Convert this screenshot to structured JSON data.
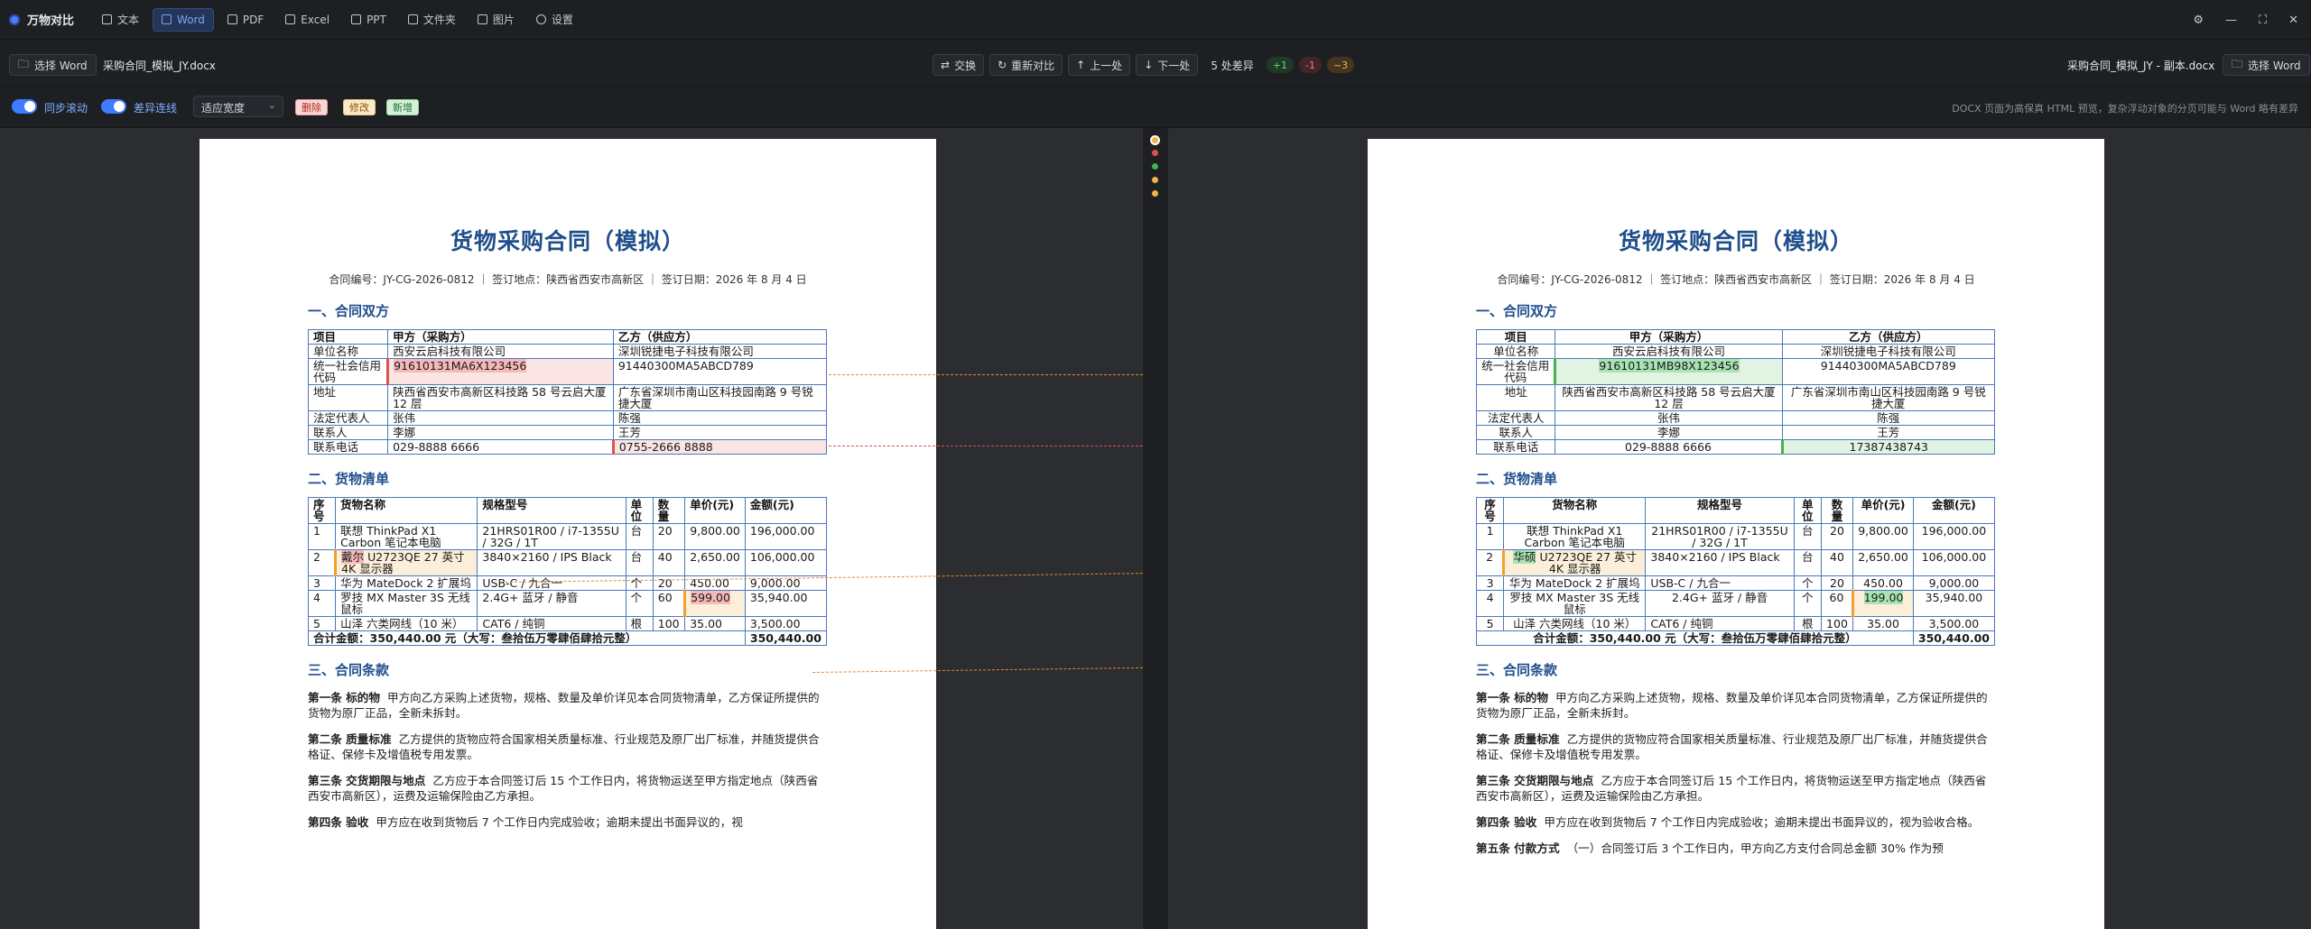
{
  "app": {
    "title": "万物对比"
  },
  "nav": [
    {
      "label": "文本",
      "icon": "document-text-icon"
    },
    {
      "label": "Word",
      "icon": "word-icon",
      "active": true
    },
    {
      "label": "PDF",
      "icon": "pdf-icon"
    },
    {
      "label": "Excel",
      "icon": "excel-icon"
    },
    {
      "label": "PPT",
      "icon": "ppt-icon"
    },
    {
      "label": "文件夹",
      "icon": "folder-icon"
    },
    {
      "label": "图片",
      "icon": "image-icon"
    },
    {
      "label": "设置",
      "icon": "gear-icon"
    }
  ],
  "window": {
    "settings": "⚙",
    "minimize": "—",
    "maximize": "⛶",
    "close": "✕"
  },
  "toolbar": {
    "select_left": "选择 Word",
    "left_file": "采购合同_模拟_JY.docx",
    "swap": "交换",
    "recompare": "重新对比",
    "prev": "上一处",
    "next": "下一处",
    "diff_count": "5 处差异",
    "added": "+1",
    "removed": "-1",
    "modified": "~3",
    "right_file": "采购合同_模拟_JY - 副本.docx",
    "select_right": "选择 Word"
  },
  "options": {
    "sync_scroll": "同步滚动",
    "diff_lines": "差异连线",
    "fit": "适应宽度",
    "legend_del": "删除",
    "legend_mod": "修改",
    "legend_add": "新增",
    "notice": "DOCX 页面为高保真 HTML 预览，复杂浮动对象的分页可能与 Word 略有差异"
  },
  "doc": {
    "title": "货物采购合同（模拟）",
    "meta": "合同编号：JY-CG-2026-0812 ｜ 签订地点：陕西省西安市高新区 ｜ 签订日期：2026 年 8 月 4 日",
    "s1": "一、合同双方",
    "parties_head": [
      "项目",
      "甲方（采购方）",
      "乙方（供应方）"
    ],
    "unit_name": [
      "单位名称",
      "西安云启科技有限公司",
      "深圳锐捷电子科技有限公司"
    ],
    "credit_label": "统一社会信用代码",
    "credit_a_left": "91610131MA6X123456",
    "credit_a_right": "91610131MB98X123456",
    "credit_b": "91440300MA5ABCD789",
    "addr": [
      "地址",
      "陕西省西安市高新区科技路 58 号云启大厦 12 层",
      "广东省深圳市南山区科技园南路 9 号锐捷大厦"
    ],
    "rep": [
      "法定代表人",
      "张伟",
      "陈强"
    ],
    "contact": [
      "联系人",
      "李娜",
      "王芳"
    ],
    "phone_label": "联系电话",
    "phone_a": "029-8888 6666",
    "phone_b_left": "0755-2666 8888",
    "phone_b_right": "17387438743",
    "s2": "二、货物清单",
    "goods_head": [
      "序号",
      "货物名称",
      "规格型号",
      "单位",
      "数量",
      "单价(元)",
      "金额(元)"
    ],
    "goods": [
      [
        "1",
        "联想 ThinkPad X1 Carbon 笔记本电脑",
        "21HRS01R00 / i7-1355U / 32G / 1T",
        "台",
        "20",
        "9,800.00",
        "196,000.00"
      ],
      [
        "2",
        "U2723QE 27 英寸 4K 显示器",
        "3840×2160 / IPS Black",
        "台",
        "40",
        "2,650.00",
        "106,000.00"
      ],
      [
        "3",
        "华为 MateDock 2 扩展坞",
        "USB-C / 九合一",
        "个",
        "20",
        "450.00",
        "9,000.00"
      ],
      [
        "4",
        "罗技 MX Master 3S 无线鼠标",
        "2.4G+ 蓝牙 / 静音",
        "个",
        "60",
        "",
        "35,940.00"
      ],
      [
        "5",
        "山泽 六类网线（10 米）",
        "CAT6 / 纯铜",
        "根",
        "100",
        "35.00",
        "3,500.00"
      ]
    ],
    "brand_left": "戴尔",
    "brand_right": "华硕",
    "price_left": "599.00",
    "price_right": "199.00",
    "total_label": "合计金额：350,440.00 元（大写：叁拾伍万零肆佰肆拾元整）",
    "total_value": "350,440.00",
    "s3": "三、合同条款",
    "c1_t": "第一条 标的物",
    "c1": "甲方向乙方采购上述货物，规格、数量及单价详见本合同货物清单，乙方保证所提供的货物为原厂正品，全新未拆封。",
    "c2_t": "第二条 质量标准",
    "c2": "乙方提供的货物应符合国家相关质量标准、行业规范及原厂出厂标准，并随货提供合格证、保修卡及增值税专用发票。",
    "c3_t": "第三条 交货期限与地点",
    "c3": "乙方应于本合同签订后 15 个工作日内，将货物运送至甲方指定地点（陕西省西安市高新区），运费及运输保险由乙方承担。",
    "c4_t": "第四条 验收",
    "c4_left": "甲方应在收到货物后 7 个工作日内完成验收；逾期未提出书面异议的，视",
    "c4_right": "甲方应在收到货物后 7 个工作日内完成验收；逾期未提出书面异议的，视为验收合格。",
    "c5_t": "第五条 付款方式",
    "c5": "（一）合同签订后 3 个工作日内，甲方向乙方支付合同总金额 30% 作为预"
  }
}
